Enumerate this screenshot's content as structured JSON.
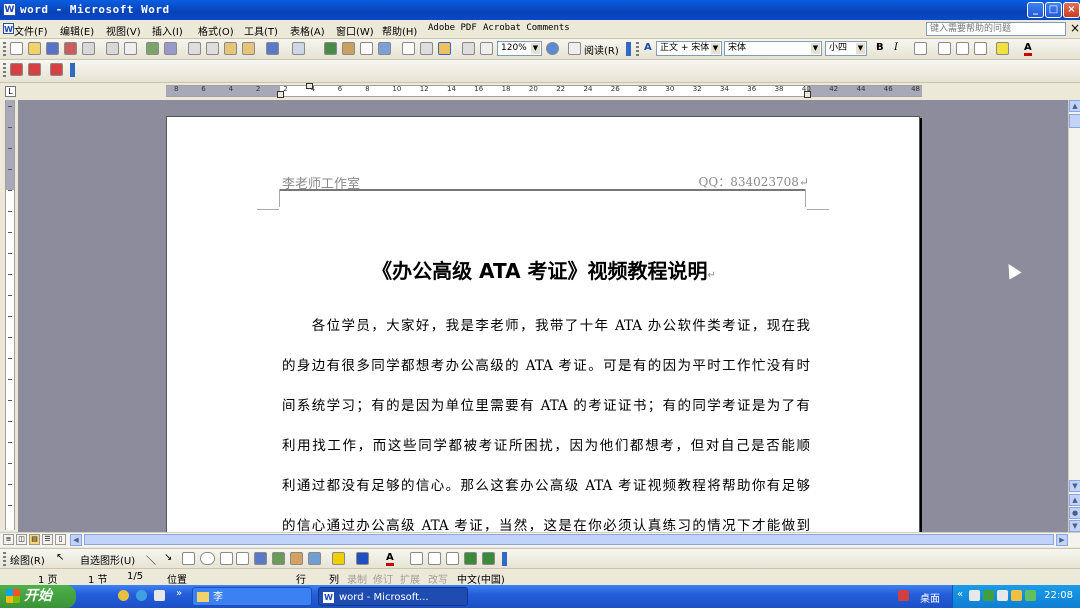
{
  "window": {
    "title": "word - Microsoft Word",
    "app_icon": "W",
    "controls": [
      "_",
      "□",
      "×"
    ]
  },
  "menubar": {
    "items": [
      "文件(F)",
      "编辑(E)",
      "视图(V)",
      "插入(I)",
      "格式(O)",
      "工具(T)",
      "表格(A)",
      "窗口(W)",
      "帮助(H)",
      "Adobe PDF",
      "Acrobat Comments"
    ],
    "help_placeholder": "键入需要帮助的问题"
  },
  "toolbar": {
    "zoom": "120%",
    "reading_label": "阅读(R)",
    "style": "正文 + 宋体",
    "font": "宋体",
    "size": "小四",
    "bold": "B",
    "italic": "I",
    "font_color_label": "A"
  },
  "ruler": {
    "numbers": [
      "8",
      "6",
      "4",
      "2",
      "2",
      "4",
      "6",
      "8",
      "10",
      "12",
      "14",
      "16",
      "18",
      "20",
      "22",
      "24",
      "26",
      "28",
      "30",
      "32",
      "34",
      "36",
      "38",
      "40",
      "42",
      "44",
      "46",
      "48"
    ]
  },
  "document": {
    "header_left": "李老师工作室",
    "header_right": "QQ：834023708↵",
    "title": "《办公高级 ATA 考证》视频教程说明",
    "title_mark": "↵",
    "lines": [
      "　　各位学员，大家好，我是李老师，我带了十年 ATA 办公软件类考证，现在我",
      "的身边有很多同学都想考办公高级的 ATA 考证。可是有的因为平时工作忙没有时",
      "间系统学习；有的是因为单位里需要有 ATA 的考证证书；有的同学考证是为了有",
      "利用找工作，而这些同学都被考证所困扰，因为他们都想考，但对自己是否能顺",
      "利通过都没有足够的信心。那么这套办公高级 ATA 考证视频教程将帮助你有足够",
      "的信心通过办公高级 ATA 考证，当然，这是在你必须认真练习的情况下才能做到"
    ]
  },
  "drawbar": {
    "draw_label": "绘图(R)",
    "autoshape_label": "自选图形(U)"
  },
  "statusbar": {
    "page": "1 页",
    "section": "1 节",
    "pages": "1/5",
    "position": "位置",
    "row": "行",
    "col": "列",
    "rec": "录制",
    "trk": "修订",
    "ext": "扩展",
    "ovr": "改写",
    "language": "中文(中国)"
  },
  "taskbar": {
    "start": "开始",
    "folder_task": "李",
    "word_task": "word - Microsoft...",
    "desktop": "桌面",
    "clock": "22:08"
  }
}
